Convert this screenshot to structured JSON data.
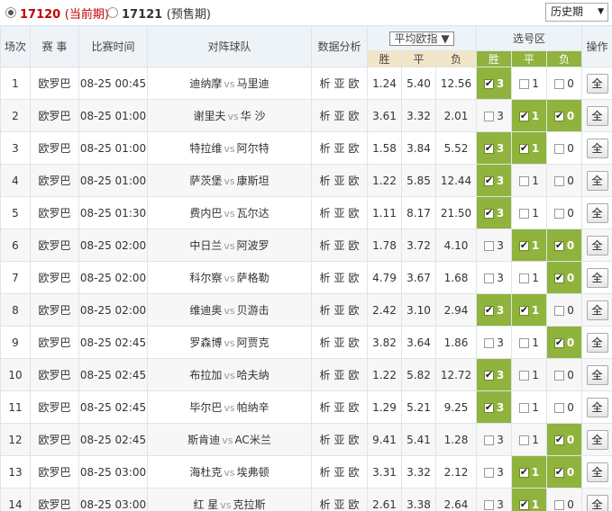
{
  "issue_bar": {
    "current_number": "17120",
    "current_tag": "(当前期)",
    "presale_number": "17121",
    "presale_tag": "(预售期)",
    "history_label": "历史期"
  },
  "headers": {
    "round": "场次",
    "league": "赛 事",
    "time": "比赛时间",
    "teams": "对阵球队",
    "analysis": "数据分析",
    "odds_selector": "平均欧指",
    "win": "胜",
    "draw": "平",
    "lose": "负",
    "pick_zone": "选号区",
    "pick_win": "胜",
    "pick_draw": "平",
    "pick_lose": "负",
    "action": "操作"
  },
  "analysis_links": [
    "析",
    "亚",
    "欧"
  ],
  "vs_label": "vs",
  "all_button": "全",
  "pick_values": [
    "3",
    "1",
    "0"
  ],
  "rows": [
    {
      "no": "1",
      "league": "欧罗巴",
      "time": "08-25 00:45",
      "home": "迪纳摩",
      "away": "马里迪",
      "win": "1.24",
      "draw": "5.40",
      "lose": "12.56",
      "picks": [
        true,
        false,
        false
      ]
    },
    {
      "no": "2",
      "league": "欧罗巴",
      "time": "08-25 01:00",
      "home": "谢里夫",
      "away": "华 沙",
      "win": "3.61",
      "draw": "3.32",
      "lose": "2.01",
      "picks": [
        false,
        true,
        true
      ]
    },
    {
      "no": "3",
      "league": "欧罗巴",
      "time": "08-25 01:00",
      "home": "特拉维",
      "away": "阿尔特",
      "win": "1.58",
      "draw": "3.84",
      "lose": "5.52",
      "picks": [
        true,
        true,
        false
      ]
    },
    {
      "no": "4",
      "league": "欧罗巴",
      "time": "08-25 01:00",
      "home": "萨茨堡",
      "away": "康斯坦",
      "win": "1.22",
      "draw": "5.85",
      "lose": "12.44",
      "picks": [
        true,
        false,
        false
      ]
    },
    {
      "no": "5",
      "league": "欧罗巴",
      "time": "08-25 01:30",
      "home": "费内巴",
      "away": "瓦尔达",
      "win": "1.11",
      "draw": "8.17",
      "lose": "21.50",
      "picks": [
        true,
        false,
        false
      ]
    },
    {
      "no": "6",
      "league": "欧罗巴",
      "time": "08-25 02:00",
      "home": "中日兰",
      "away": "阿波罗",
      "win": "1.78",
      "draw": "3.72",
      "lose": "4.10",
      "picks": [
        false,
        true,
        true
      ]
    },
    {
      "no": "7",
      "league": "欧罗巴",
      "time": "08-25 02:00",
      "home": "科尔察",
      "away": "萨格勒",
      "win": "4.79",
      "draw": "3.67",
      "lose": "1.68",
      "picks": [
        false,
        false,
        true
      ]
    },
    {
      "no": "8",
      "league": "欧罗巴",
      "time": "08-25 02:00",
      "home": "维迪奥",
      "away": "贝游击",
      "win": "2.42",
      "draw": "3.10",
      "lose": "2.94",
      "picks": [
        true,
        true,
        false
      ]
    },
    {
      "no": "9",
      "league": "欧罗巴",
      "time": "08-25 02:45",
      "home": "罗森博",
      "away": "阿贾克",
      "win": "3.82",
      "draw": "3.64",
      "lose": "1.86",
      "picks": [
        false,
        false,
        true
      ]
    },
    {
      "no": "10",
      "league": "欧罗巴",
      "time": "08-25 02:45",
      "home": "布拉加",
      "away": "哈夫纳",
      "win": "1.22",
      "draw": "5.82",
      "lose": "12.72",
      "picks": [
        true,
        false,
        false
      ]
    },
    {
      "no": "11",
      "league": "欧罗巴",
      "time": "08-25 02:45",
      "home": "毕尔巴",
      "away": "帕纳辛",
      "win": "1.29",
      "draw": "5.21",
      "lose": "9.25",
      "picks": [
        true,
        false,
        false
      ]
    },
    {
      "no": "12",
      "league": "欧罗巴",
      "time": "08-25 02:45",
      "home": "斯肯迪",
      "away": "AC米兰",
      "win": "9.41",
      "draw": "5.41",
      "lose": "1.28",
      "picks": [
        false,
        false,
        true
      ]
    },
    {
      "no": "13",
      "league": "欧罗巴",
      "time": "08-25 03:00",
      "home": "海杜克",
      "away": "埃弗顿",
      "win": "3.31",
      "draw": "3.32",
      "lose": "2.12",
      "picks": [
        false,
        true,
        true
      ]
    },
    {
      "no": "14",
      "league": "欧罗巴",
      "time": "08-25 03:00",
      "home": "红 星",
      "away": "克拉斯",
      "win": "2.61",
      "draw": "3.38",
      "lose": "2.64",
      "picks": [
        false,
        true,
        false
      ]
    }
  ],
  "colors": {
    "accent_red": "#c40000",
    "pick_green": "#8fb33c",
    "odds_header": "#f2e6c8",
    "header_bg": "#eef3f7"
  }
}
